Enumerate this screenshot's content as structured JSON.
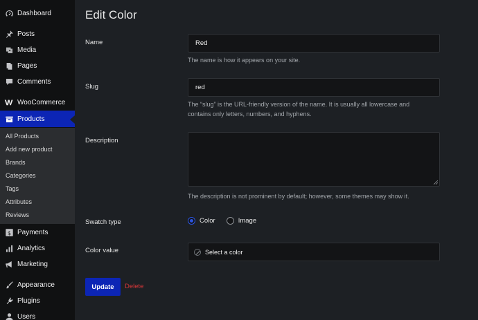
{
  "sidebar": {
    "items": [
      {
        "label": "Dashboard",
        "icon": "dashboard-icon"
      },
      {
        "label": "Posts",
        "icon": "pin-icon"
      },
      {
        "label": "Media",
        "icon": "media-icon"
      },
      {
        "label": "Pages",
        "icon": "pages-icon"
      },
      {
        "label": "Comments",
        "icon": "comment-icon"
      },
      {
        "label": "WooCommerce",
        "icon": "woo-icon"
      },
      {
        "label": "Products",
        "icon": "products-icon"
      },
      {
        "label": "Payments",
        "icon": "payments-icon"
      },
      {
        "label": "Analytics",
        "icon": "analytics-icon"
      },
      {
        "label": "Marketing",
        "icon": "megaphone-icon"
      },
      {
        "label": "Appearance",
        "icon": "brush-icon"
      },
      {
        "label": "Plugins",
        "icon": "plug-icon"
      },
      {
        "label": "Users",
        "icon": "user-icon"
      }
    ],
    "submenu": [
      "All Products",
      "Add new product",
      "Brands",
      "Categories",
      "Tags",
      "Attributes",
      "Reviews"
    ]
  },
  "page": {
    "title": "Edit Color"
  },
  "form": {
    "name_label": "Name",
    "name_value": "Red",
    "name_help": "The name is how it appears on your site.",
    "slug_label": "Slug",
    "slug_value": "red",
    "slug_help_1": "The “slug” is the URL-friendly version of the name. It is usually all lowercase and",
    "slug_help_2": "contains only letters, numbers, and hyphens.",
    "description_label": "Description",
    "description_value": "",
    "description_help": "The description is not prominent by default; however, some themes may show it.",
    "swatch_label": "Swatch type",
    "swatch_options": [
      "Color",
      "Image"
    ],
    "swatch_selected": "Color",
    "color_label": "Color value",
    "color_placeholder": "Select a color",
    "update_label": "Update",
    "delete_label": "Delete"
  },
  "colors": {
    "accent": "#0c25b5",
    "delete": "#d63638",
    "background": "#1d2024",
    "sidebar": "#101112"
  }
}
